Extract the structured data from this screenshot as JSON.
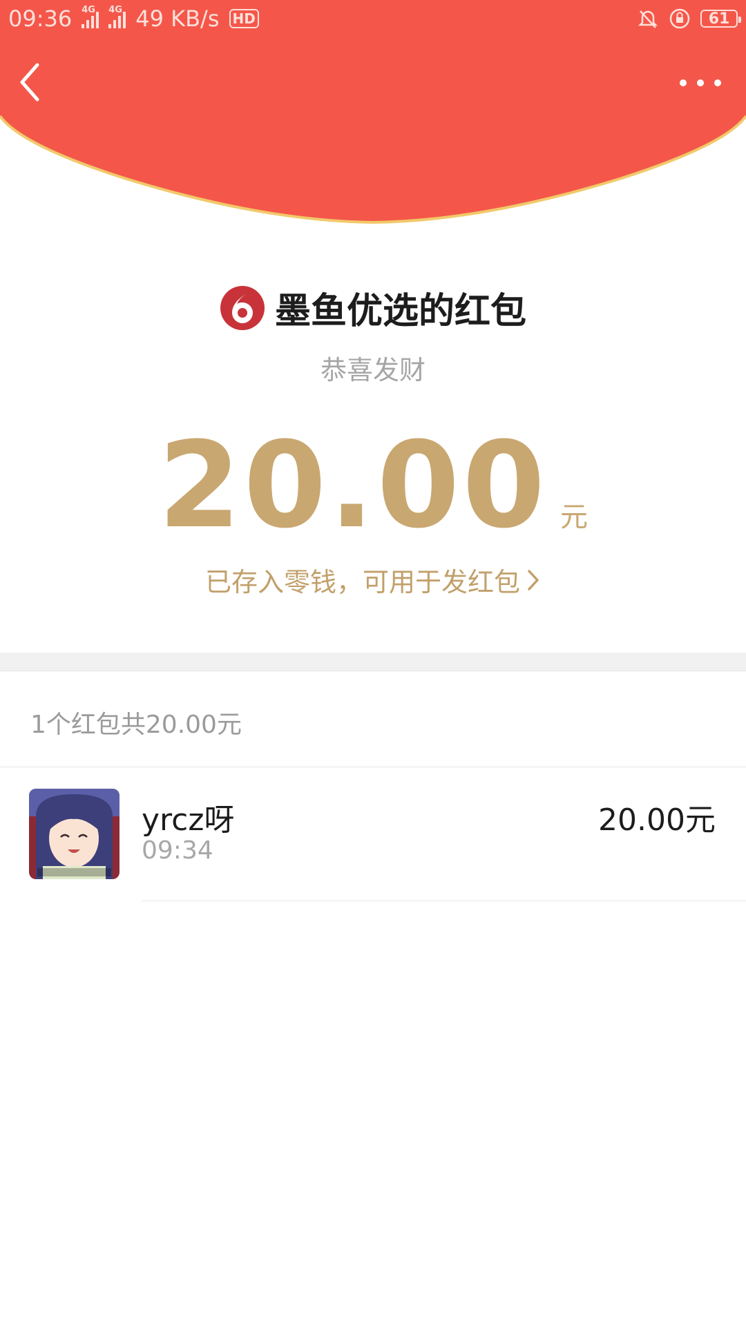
{
  "status_bar": {
    "time": "09:36",
    "network_1": "4G",
    "network_2": "4G",
    "speed": "49 KB/s",
    "hd_label": "HD",
    "battery": "61"
  },
  "header": {
    "background_color": "#f4574a",
    "arc_border_color": "#f2c96a"
  },
  "packet": {
    "sender_title": "墨鱼优选的红包",
    "blessing": "恭喜发财",
    "amount": "20.00",
    "unit": "元",
    "note": "已存入零钱，可用于发红包",
    "accent_color": "#c9a771"
  },
  "summary": {
    "text": "1个红包共20.00元"
  },
  "recipients": [
    {
      "name": "yrcz呀",
      "time": "09:34",
      "amount": "20.00元"
    }
  ]
}
